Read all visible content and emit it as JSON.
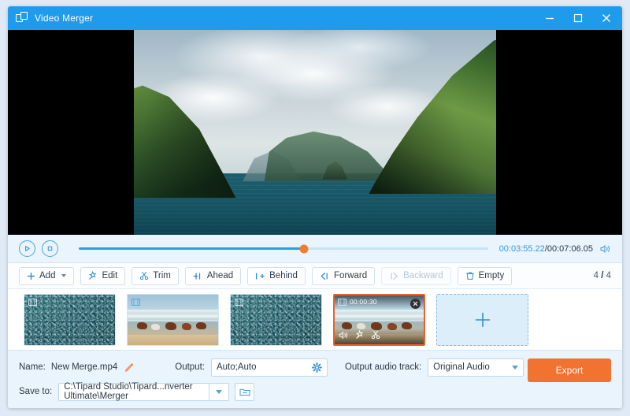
{
  "window": {
    "title": "Video Merger",
    "logo_icon": "merge-windows-icon",
    "controls": {
      "minimize": "minimize-icon",
      "maximize": "maximize-icon",
      "close": "close-icon"
    }
  },
  "preview": {
    "alt": "coastal cliffs and sea video frame"
  },
  "player": {
    "play_icon": "play-icon",
    "stop_icon": "stop-icon",
    "current_time": "00:03:55.22",
    "separator": "/",
    "total_time": "00:07:06.05",
    "progress_percent": 55,
    "volume_icon": "volume-icon"
  },
  "toolbar": {
    "buttons": [
      {
        "label": "Add",
        "icon": "plus-icon",
        "disabled": false,
        "has_caret": true
      },
      {
        "label": "Edit",
        "icon": "magic-wand-icon",
        "disabled": false,
        "has_caret": false
      },
      {
        "label": "Trim",
        "icon": "scissors-icon",
        "disabled": false,
        "has_caret": false
      },
      {
        "label": "Ahead",
        "icon": "insert-ahead-icon",
        "disabled": false,
        "has_caret": false
      },
      {
        "label": "Behind",
        "icon": "insert-behind-icon",
        "disabled": false,
        "has_caret": false
      },
      {
        "label": "Forward",
        "icon": "move-forward-icon",
        "disabled": false,
        "has_caret": false
      },
      {
        "label": "Backward",
        "icon": "move-backward-icon",
        "disabled": true,
        "has_caret": false
      },
      {
        "label": "Empty",
        "icon": "trash-icon",
        "disabled": false,
        "has_caret": false
      }
    ],
    "counter_current": "4",
    "counter_separator": "/",
    "counter_total": "4"
  },
  "clips": [
    {
      "kind": "noise",
      "selected": false,
      "corner_icon": "film-clip-icon"
    },
    {
      "kind": "horses",
      "selected": false,
      "corner_icon": "film-clip-icon"
    },
    {
      "kind": "noise",
      "selected": false,
      "corner_icon": "film-clip-icon"
    },
    {
      "kind": "horses",
      "selected": true,
      "corner_icon": "film-clip-icon",
      "duration": "00:00:30",
      "close_icon": "remove-clip-icon",
      "tools": [
        "volume-icon",
        "magic-wand-icon",
        "scissors-icon"
      ]
    }
  ],
  "add_slot": {
    "icon": "plus-icon",
    "label": ""
  },
  "settings": {
    "name_label": "Name:",
    "name_value": "New Merge.mp4",
    "edit_name_icon": "pencil-icon",
    "output_label": "Output:",
    "output_value": "Auto;Auto",
    "output_gear_icon": "gear-icon",
    "audio_track_label": "Output audio track:",
    "audio_track_value": "Original Audio",
    "audio_track_caret_icon": "chevron-down-icon",
    "save_to_label": "Save to:",
    "save_to_value": "C:\\Tipard Studio\\Tipard...nverter Ultimate\\Merger",
    "save_to_caret_icon": "chevron-down-icon",
    "browse_icon": "folder-icon",
    "export_label": "Export"
  },
  "colors": {
    "titlebar": "#1f9bee",
    "accent_blue": "#2f9ae0",
    "export_orange": "#f2722f",
    "selected_border": "#e9642c",
    "panel_blue": "#eaf4fc"
  }
}
